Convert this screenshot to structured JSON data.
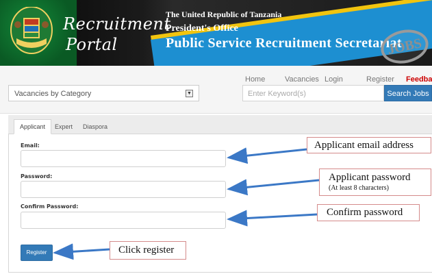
{
  "header": {
    "portal_line1": "Recruitment",
    "portal_line2": "Portal",
    "gov_line1": "The United Republic of Tanzania",
    "gov_line2": "President's Office",
    "gov_line3": "Public Service Recruitment Secretariat",
    "badge_text": "JOBS"
  },
  "nav": {
    "home": "Home",
    "vacancies": "Vacancies",
    "login": "Login",
    "register": "Register",
    "feedback": "Feedback"
  },
  "search": {
    "category_value": "Vacancies by Category",
    "keyword_placeholder": "Enter Keyword(s)",
    "button_label": "Search Jobs"
  },
  "tabs": {
    "applicant": "Applicant",
    "expert": "Expert",
    "diaspora": "Diaspora"
  },
  "form": {
    "email_label": "Email:",
    "password_label": "Password:",
    "confirm_label": "Confirm Password:",
    "register_label": "Register"
  },
  "annotations": {
    "email": "Applicant email address",
    "password_line1": "Applicant password",
    "password_line2": "(At least 8 characters)",
    "confirm": "Confirm password",
    "register": "Click register"
  },
  "colors": {
    "primary_blue": "#337ab7",
    "feedback_red": "#cc0000",
    "arrow_blue": "#3b78c6",
    "callout_border": "#d48a8a"
  }
}
